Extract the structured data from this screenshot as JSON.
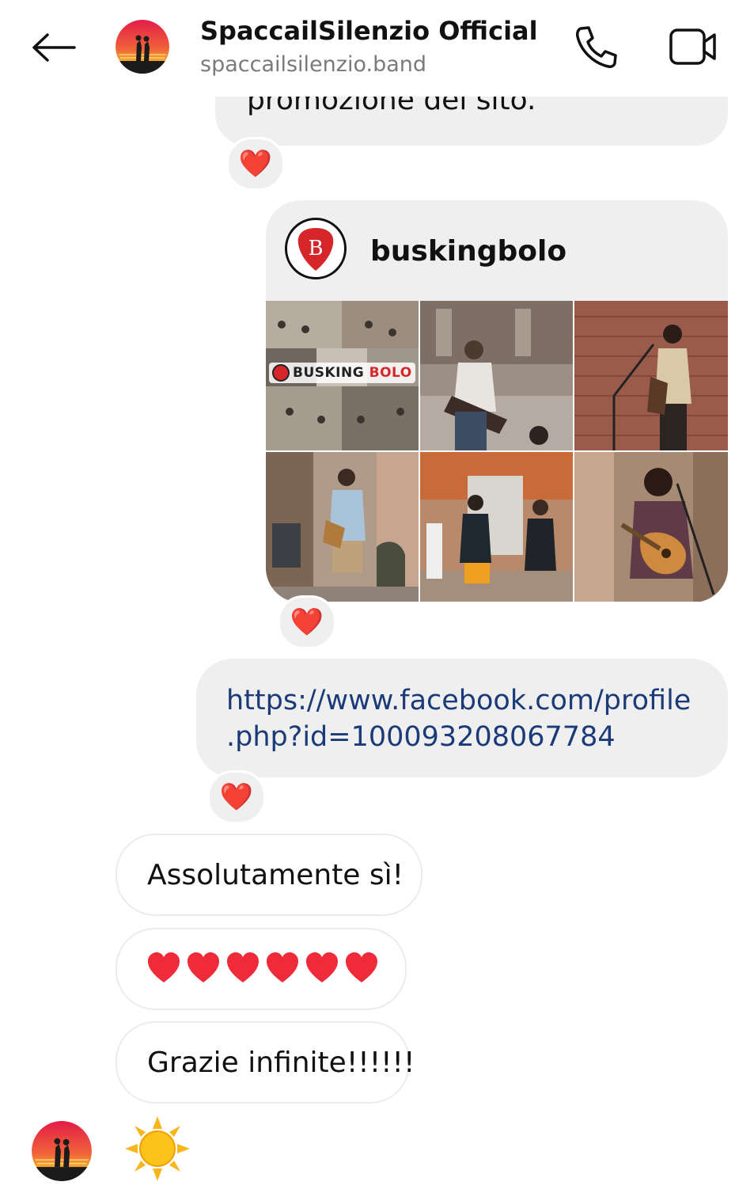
{
  "header": {
    "title": "SpaccailSilenzio Official",
    "subtitle": "spaccailsilenzio.band"
  },
  "messages": {
    "partial_text": "promozione del sito.",
    "share": {
      "account": "buskingbolo",
      "tile_brand_prefix": "BUSKING",
      "tile_brand_suffix": "BOLO"
    },
    "link": {
      "line1": "https://www.facebook.com/profile",
      "line2": ".php?id=100093208067784"
    },
    "incoming": [
      {
        "text": "Assolutamente sì!"
      },
      {
        "text": ""
      },
      {
        "text": "Grazie infinite!!!!!!"
      }
    ],
    "reaction_emoji": "❤️",
    "heart_count": 6
  },
  "colors": {
    "bubble_gray": "#efefef",
    "link_blue": "#1a3a78",
    "heart_red": "#ef2b3a",
    "brand_red": "#d7262a"
  },
  "icons": [
    "back-arrow-icon",
    "phone-icon",
    "video-camera-icon",
    "heart-icon",
    "sun-emoji-icon"
  ]
}
